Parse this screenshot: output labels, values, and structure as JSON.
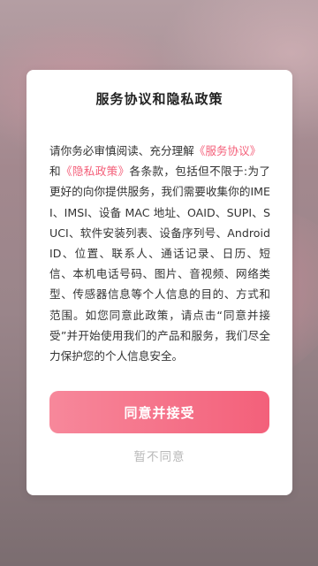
{
  "dialog": {
    "title": "服务协议和隐私政策",
    "intro": "请你务必审慎阅读、充分理解",
    "service_agreement_link": "《服务协议》",
    "and_text": "和",
    "privacy_policy_link": "《隐私政策》",
    "body": "各条款，包括但不限于:为了更好的向你提供服务，我们需要收集你的IMEI、IMSI、设备 MAC 地址、OAID、SUPI、SUCI、软件安装列表、设备序列号、Android ID、位置、联系人、通话记录、日历、短信、本机电话号码、图片、音视频、网络类型、传感器信息等个人信息的目的、方式和范围。如您同意此政策，请点击“同意并接受”并开始使用我们的产品和服务，我们尽全力保护您的个人信息安全。",
    "agree_button": "同意并接受",
    "disagree_button": "暂不同意"
  },
  "colors": {
    "accent": "#f4607a",
    "button_gradient_start": "#f7889b",
    "button_gradient_end": "#f3607a",
    "muted": "#b8b8b8"
  }
}
